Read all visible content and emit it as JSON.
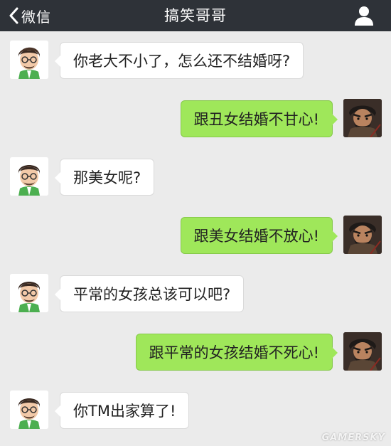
{
  "header": {
    "back_label": "微信",
    "title": "搞笑哥哥",
    "back_icon": "chevron-left-icon",
    "profile_icon": "person-icon"
  },
  "messages": [
    {
      "side": "left",
      "text": "你老大不小了，怎么还不结婚呀?"
    },
    {
      "side": "right",
      "text": "跟丑女结婚不甘心!"
    },
    {
      "side": "left",
      "text": "那美女呢?"
    },
    {
      "side": "right",
      "text": "跟美女结婚不放心!"
    },
    {
      "side": "left",
      "text": "平常的女孩总该可以吧?"
    },
    {
      "side": "right",
      "text": "跟平常的女孩结婚不死心!"
    },
    {
      "side": "left",
      "text": "你TM出家算了!"
    }
  ],
  "watermark": "GAMERSKY",
  "colors": {
    "header_bg": "#2e3238",
    "chat_bg": "#ebebeb",
    "incoming_bubble": "#ffffff",
    "outgoing_bubble": "#9fe75a"
  }
}
